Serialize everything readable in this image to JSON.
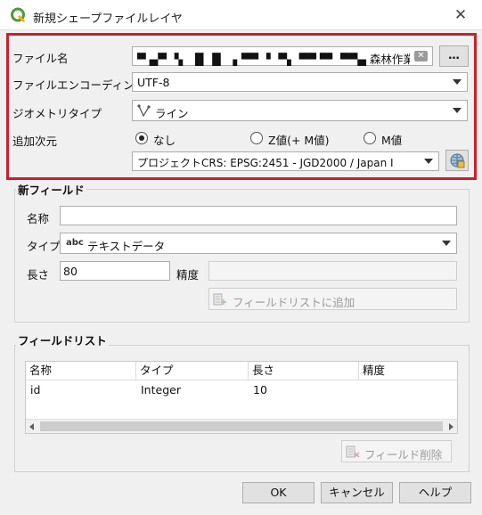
{
  "window": {
    "title": "新規シェープファイルレイヤ",
    "close_glyph": "✕"
  },
  "form": {
    "file_name_label": "ファイル名",
    "file_name_value": "▀ ▄▀ ▝▖ ▐▌▐▌  ▗▝▀▘ ▘ ▀▖ ▀▀ ▀▘ ▀▀▄ 森林作業道.shp",
    "file_browse_label": "…",
    "encoding_label": "ファイルエンコーディング",
    "encoding_value": "UTF-8",
    "geometry_label": "ジオメトリタイプ",
    "geometry_value": "ライン",
    "dimension_label": "追加次元",
    "dimension_options": [
      "なし",
      "Z値(+ M値)",
      "M値"
    ],
    "dimension_selected": "なし",
    "crs_value": "プロジェクトCRS: EPSG:2451 - JGD2000 / Japan I"
  },
  "new_field": {
    "group_title": "新フィールド",
    "name_label": "名称",
    "name_value": "",
    "type_label": "タイプ",
    "type_badge": "abc",
    "type_value": "テキストデータ",
    "length_label": "長さ",
    "length_value": "80",
    "precision_label": "精度",
    "precision_value": "",
    "add_button_label": "フィールドリストに追加"
  },
  "field_list": {
    "group_title": "フィールドリスト",
    "columns": [
      "名称",
      "タイプ",
      "長さ",
      "精度"
    ],
    "rows": [
      [
        "id",
        "Integer",
        "10",
        ""
      ]
    ],
    "delete_button_label": "フィールド削除"
  },
  "buttons": {
    "ok": "OK",
    "cancel": "キャンセル",
    "help": "ヘルプ"
  },
  "icons": {
    "app": "qgis-logo-icon",
    "close": "close-icon",
    "clear": "clear-text-icon",
    "geometry": "line-geometry-icon",
    "crs_picker": "globe-crs-icon",
    "add_field": "add-field-icon",
    "delete_field": "delete-field-icon"
  },
  "colors": {
    "highlight_box": "#c8202a",
    "qgis_green": "#4e9a3a"
  }
}
